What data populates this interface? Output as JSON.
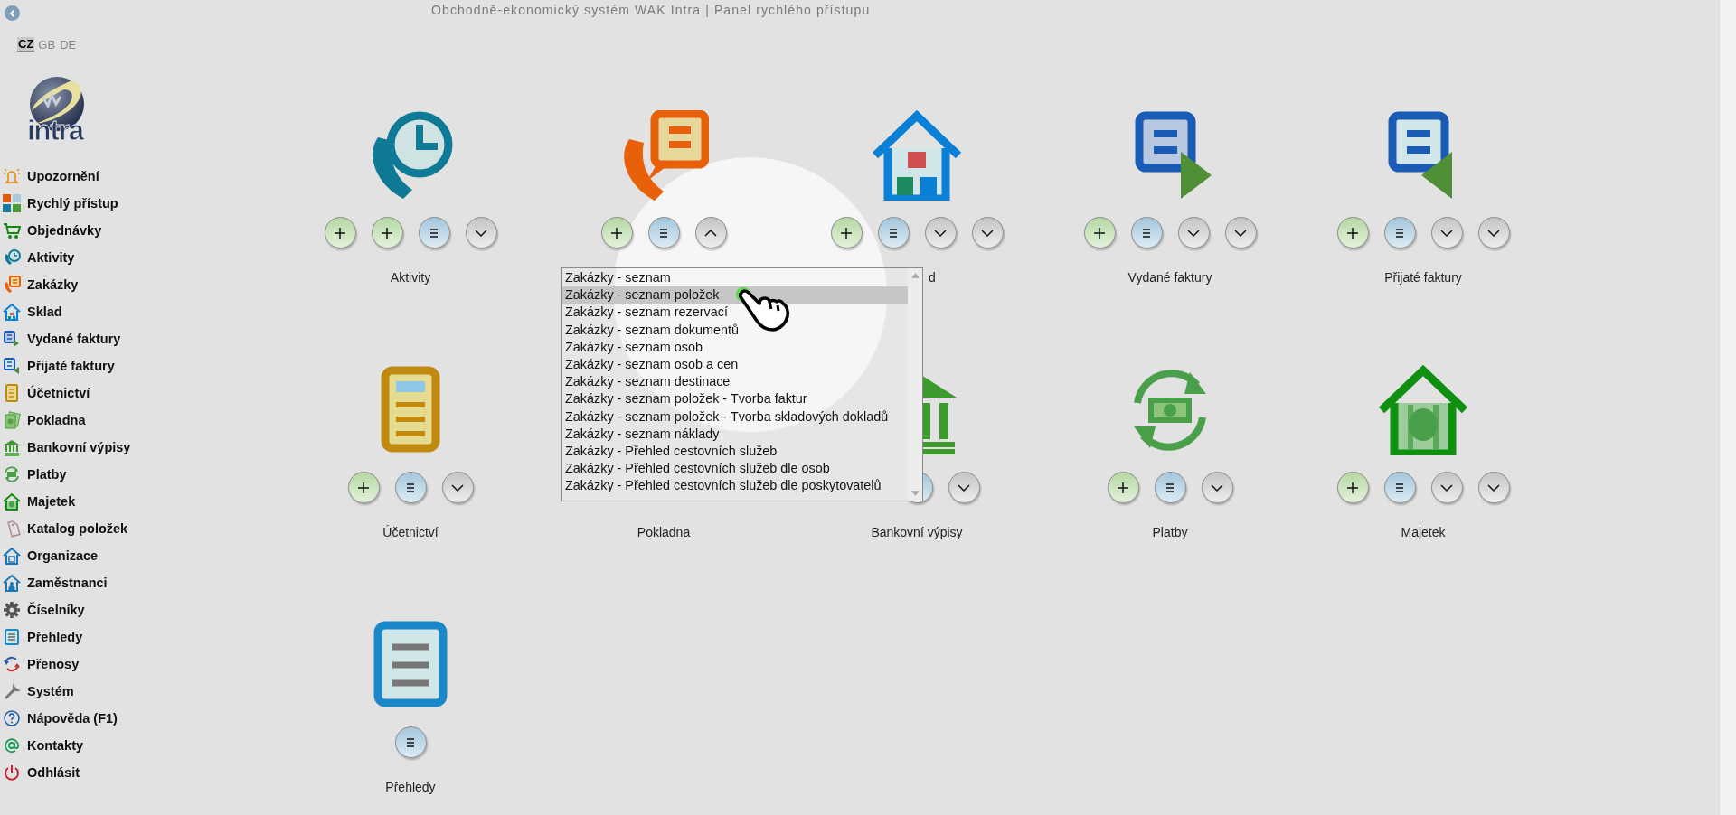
{
  "header": {
    "title": "Obchodně-ekonomický systém WAK Intra | Panel rychlého přístupu"
  },
  "languages": [
    {
      "code": "CZ",
      "selected": true
    },
    {
      "code": "GB",
      "selected": false
    },
    {
      "code": "DE",
      "selected": false
    }
  ],
  "logo": {
    "text": "intra"
  },
  "sidebar": {
    "items": [
      {
        "label": "Upozornění"
      },
      {
        "label": "Rychlý přístup"
      },
      {
        "label": "Objednávky"
      },
      {
        "label": "Aktivity"
      },
      {
        "label": "Zakázky"
      },
      {
        "label": "Sklad"
      },
      {
        "label": "Vydané faktury"
      },
      {
        "label": "Přijaté faktury"
      },
      {
        "label": "Účetnictví"
      },
      {
        "label": "Pokladna"
      },
      {
        "label": "Bankovní výpisy"
      },
      {
        "label": "Platby"
      },
      {
        "label": "Majetek"
      },
      {
        "label": "Katalog položek"
      },
      {
        "label": "Organizace"
      },
      {
        "label": "Zaměstnanci"
      },
      {
        "label": "Číselníky"
      },
      {
        "label": "Přehledy"
      },
      {
        "label": "Přenosy"
      },
      {
        "label": "Systém"
      },
      {
        "label": "Nápověda (F1)"
      },
      {
        "label": "Kontakty"
      },
      {
        "label": "Odhlásit"
      }
    ]
  },
  "tiles": [
    {
      "label": "Aktivity",
      "buttons": [
        {
          "kind": "add"
        },
        {
          "kind": "add"
        },
        {
          "kind": "list"
        },
        {
          "kind": "down"
        }
      ]
    },
    {
      "buttons": [
        {
          "kind": "add"
        },
        {
          "kind": "list"
        },
        {
          "kind": "up"
        }
      ]
    },
    {
      "label": "d",
      "partly_hidden": true,
      "buttons": [
        {
          "kind": "add"
        },
        {
          "kind": "list"
        },
        {
          "kind": "down"
        },
        {
          "kind": "down"
        }
      ]
    },
    {
      "label": "Vydané faktury",
      "buttons": [
        {
          "kind": "add"
        },
        {
          "kind": "list"
        },
        {
          "kind": "down"
        },
        {
          "kind": "down"
        }
      ]
    },
    {
      "label": "Přijaté faktury",
      "buttons": [
        {
          "kind": "add"
        },
        {
          "kind": "list"
        },
        {
          "kind": "down"
        },
        {
          "kind": "down"
        }
      ]
    },
    {
      "label": "Účetnictví",
      "buttons": [
        {
          "kind": "add"
        },
        {
          "kind": "list"
        },
        {
          "kind": "down"
        }
      ]
    },
    {
      "label": "Pokladna"
    },
    {
      "label": "Bankovní výpisy",
      "buttons": [
        {
          "kind": "covered"
        },
        {
          "kind": "list_edge"
        },
        {
          "kind": "down"
        }
      ]
    },
    {
      "label": "Platby",
      "buttons": [
        {
          "kind": "add"
        },
        {
          "kind": "list"
        },
        {
          "kind": "down"
        }
      ]
    },
    {
      "label": "Majetek",
      "buttons": [
        {
          "kind": "add"
        },
        {
          "kind": "list"
        },
        {
          "kind": "down"
        },
        {
          "kind": "down"
        }
      ]
    },
    {
      "label": "Přehledy",
      "buttons": [
        {
          "kind": "list"
        }
      ]
    }
  ],
  "dropdown": {
    "items": [
      {
        "label": "Zakázky - seznam",
        "selected": false
      },
      {
        "label": "Zakázky - seznam položek",
        "selected": true
      },
      {
        "label": "Zakázky - seznam rezervací",
        "selected": false
      },
      {
        "label": "Zakázky - seznam dokumentů",
        "selected": false
      },
      {
        "label": "Zakázky - seznam osob",
        "selected": false
      },
      {
        "label": "Zakázky - seznam osob a cen",
        "selected": false
      },
      {
        "label": "Zakázky - seznam destinace",
        "selected": false
      },
      {
        "label": "Zakázky - seznam položek - Tvorba faktur",
        "selected": false
      },
      {
        "label": "Zakázky - seznam položek - Tvorba skladových dokladů",
        "selected": false
      },
      {
        "label": "Zakázky - seznam náklady",
        "selected": false
      },
      {
        "label": "Zakázky - Přehled cestovních služeb",
        "selected": false
      },
      {
        "label": "Zakázky - Přehled cestovních služeb dle osob",
        "selected": false
      },
      {
        "label": "Zakázky - Přehled cestovních služeb dle poskytovatelů",
        "selected": false
      }
    ]
  }
}
